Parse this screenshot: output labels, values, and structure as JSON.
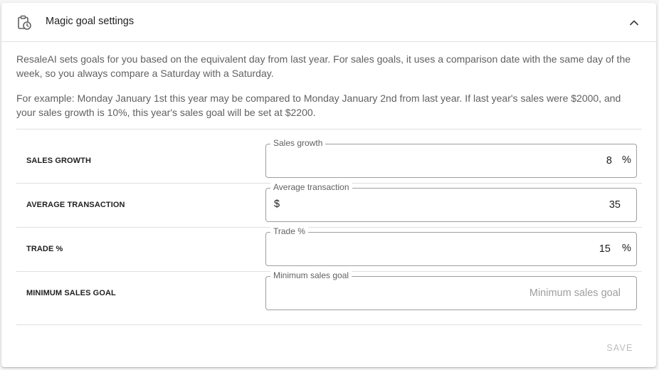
{
  "header": {
    "title": "Magic goal settings",
    "icon": "clipboard-clock-icon",
    "collapse_icon": "chevron-up-icon"
  },
  "description": {
    "paragraph1": "ResaleAI sets goals for you based on the equivalent day from last year. For sales goals, it uses a comparison date with the same day of the week, so you always compare a Saturday with a Saturday.",
    "paragraph2": "For example: Monday January 1st this year may be compared to Monday January 2nd from last year. If last year's sales were $2000, and your sales growth is 10%, this year's sales goal will be set at $2200."
  },
  "rows": [
    {
      "label": "SALES GROWTH",
      "field_label": "Sales growth",
      "value": "8",
      "suffix": "%"
    },
    {
      "label": "AVERAGE TRANSACTION",
      "field_label": "Average transaction",
      "value": "35",
      "prefix": "$"
    },
    {
      "label": "TRADE %",
      "field_label": "Trade %",
      "value": "15",
      "suffix": "%"
    },
    {
      "label": "MINIMUM SALES GOAL",
      "field_label": "Minimum sales goal",
      "value": "",
      "placeholder": "Minimum sales goal"
    }
  ],
  "save_label": "SAVE"
}
